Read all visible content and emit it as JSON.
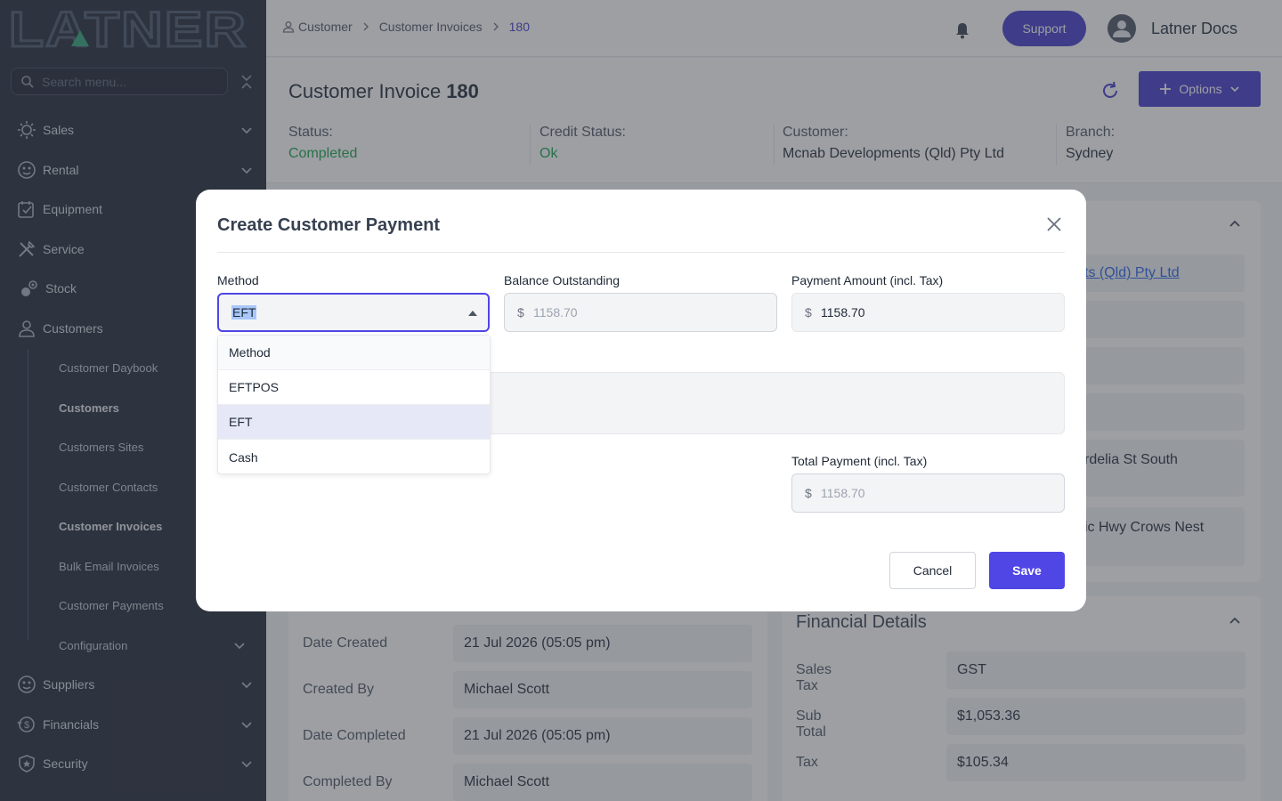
{
  "brand": {
    "logo_text": "LATNER",
    "accent": "#4338ca"
  },
  "sidebar": {
    "search_placeholder": "Search menu...",
    "items": [
      {
        "label": "Sales",
        "icon": "sales-icon"
      },
      {
        "label": "Rental",
        "icon": "rental-icon"
      },
      {
        "label": "Equipment",
        "icon": "equipment-icon"
      },
      {
        "label": "Service",
        "icon": "service-icon"
      },
      {
        "label": "Stock",
        "icon": "stock-icon"
      },
      {
        "label": "Customers",
        "icon": "user-icon"
      },
      {
        "label": "Suppliers",
        "icon": "suppliers-icon"
      },
      {
        "label": "Financials",
        "icon": "financials-icon"
      },
      {
        "label": "Security",
        "icon": "shield-icon"
      }
    ],
    "customer_subitems": [
      "Customer Daybook",
      "Customers",
      "Customers Sites",
      "Customer Contacts",
      "Customer Invoices",
      "Bulk Email Invoices",
      "Customer Payments",
      "Configuration"
    ]
  },
  "header": {
    "breadcrumb": [
      "Customer",
      "Customer Invoices",
      "180"
    ],
    "support_label": "Support",
    "username": "Latner Docs"
  },
  "page": {
    "title": "Customer Invoice",
    "invoice_number": "180",
    "options_label": "Options",
    "status": {
      "label": "Status:",
      "value": "Completed"
    },
    "credit_status": {
      "label": "Credit Status:",
      "value": "Ok"
    },
    "customer": {
      "label": "Customer:",
      "value": "Mcnab Developments (Qld) Pty Ltd"
    },
    "branch": {
      "label": "Branch:",
      "value": "Sydney"
    }
  },
  "background": {
    "customer_link_partial": "ts (Qld) Pty Ltd",
    "address_partial_1": "rdelia St South",
    "address_partial_2": "ic Hwy Crows Nest",
    "details": [
      {
        "label": "Date Created",
        "value": "21 Jul 2026 (05:05 pm)"
      },
      {
        "label": "Created By",
        "value": "Michael Scott"
      },
      {
        "label": "Date Completed",
        "value": "21 Jul 2026 (05:05 pm)"
      },
      {
        "label": "Completed By",
        "value": "Michael Scott"
      }
    ],
    "financial": {
      "title": "Financial Details",
      "rows": [
        {
          "label": "Sales Tax",
          "value": "GST"
        },
        {
          "label": "Sub Total",
          "value": "$1,053.36"
        },
        {
          "label": "Tax",
          "value": "$105.34"
        }
      ]
    }
  },
  "modal": {
    "title": "Create Customer Payment",
    "method": {
      "label": "Method",
      "value": "EFT"
    },
    "balance": {
      "label": "Balance Outstanding",
      "currency": "$",
      "value": "1158.70"
    },
    "payment_amount": {
      "label": "Payment Amount (incl. Tax)",
      "currency": "$",
      "value": "1158.70"
    },
    "total_payment": {
      "label": "Total Payment (incl. Tax)",
      "currency": "$",
      "value": "1158.70"
    },
    "method_options": [
      "Method",
      "EFTPOS",
      "EFT",
      "Cash"
    ],
    "selected_option": "EFT",
    "cancel_label": "Cancel",
    "save_label": "Save"
  }
}
